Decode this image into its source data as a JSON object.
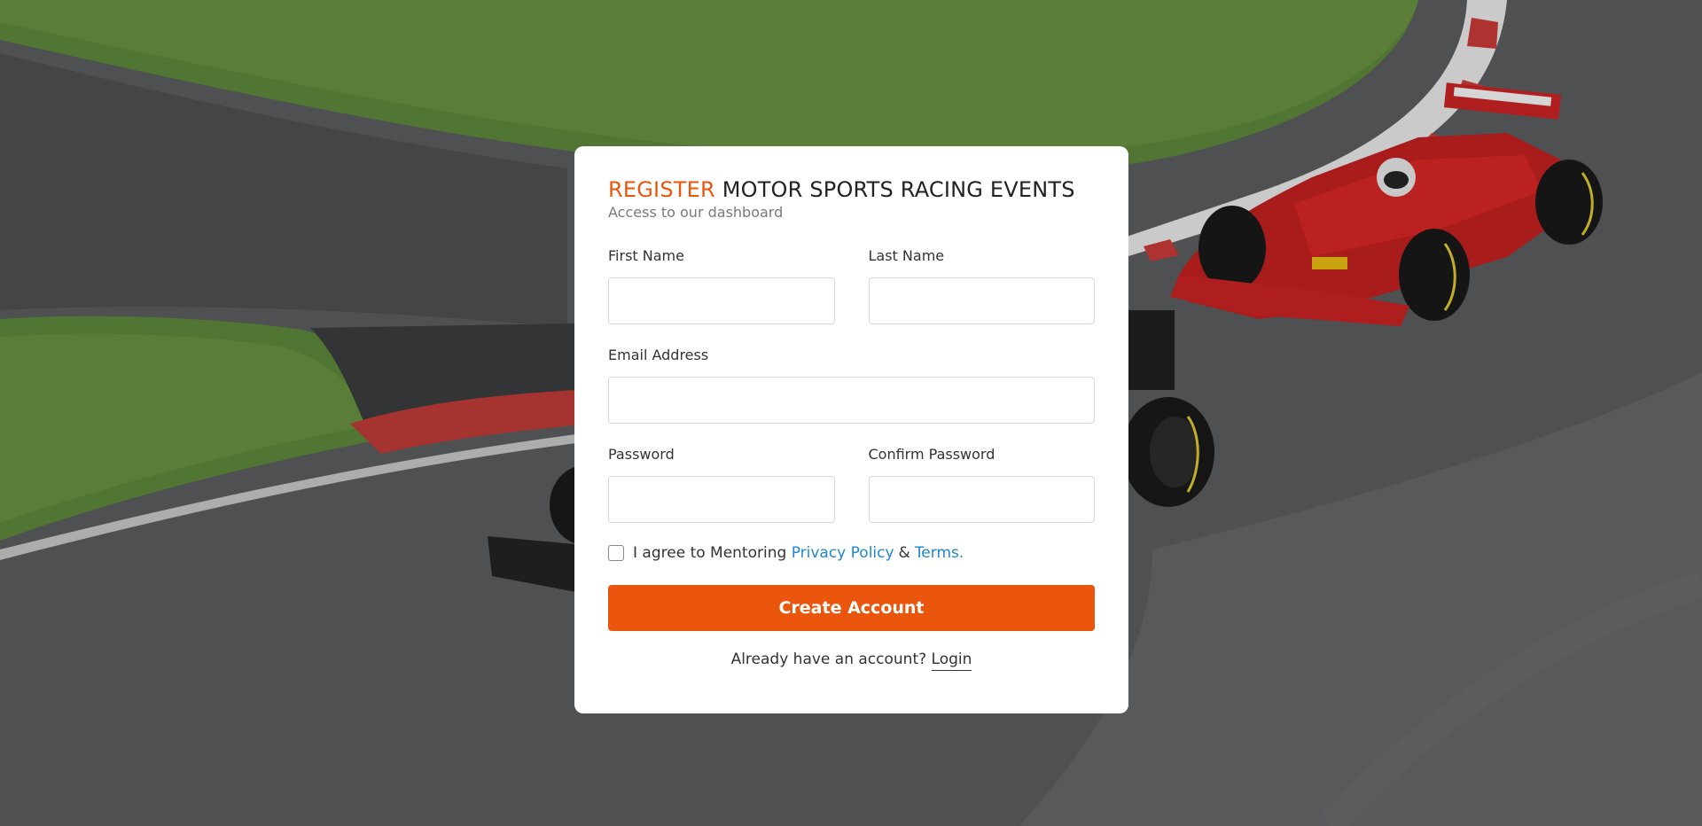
{
  "page": {
    "title_accent": "REGISTER",
    "title_rest": "MOTOR SPORTS RACING EVENTS",
    "subtitle": "Access to our dashboard"
  },
  "form": {
    "first_name_label": "First Name",
    "last_name_label": "Last Name",
    "email_label": "Email Address",
    "password_label": "Password",
    "confirm_password_label": "Confirm Password",
    "first_name_value": "",
    "last_name_value": "",
    "email_value": "",
    "password_value": "",
    "confirm_password_value": ""
  },
  "agreement": {
    "prefix": "I agree to Mentoring",
    "privacy_link": "Privacy Policy",
    "separator": "&",
    "terms_link": "Terms.",
    "checked": false
  },
  "actions": {
    "create_account_label": "Create Account",
    "login_prompt": "Already have an account?",
    "login_link": "Login"
  },
  "colors": {
    "accent": "#ea560d",
    "link": "#1e88d6"
  }
}
